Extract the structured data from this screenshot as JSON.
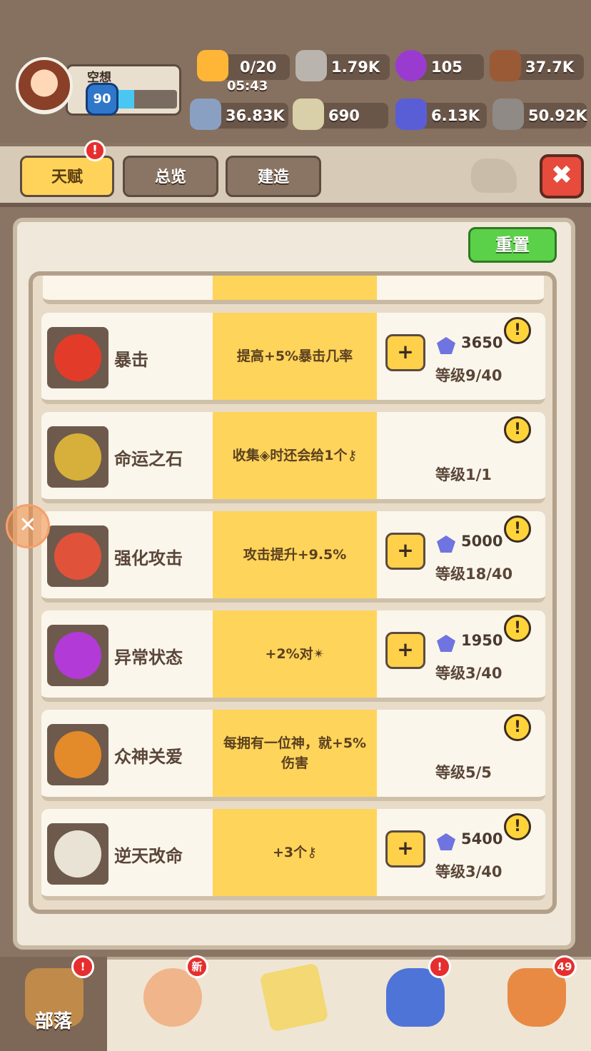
{
  "player": {
    "name": "空想",
    "level": "90",
    "xp_fraction": 0.33
  },
  "resources": {
    "energy": {
      "value": "0/20",
      "timer": "05:43",
      "icon": "meat-icon"
    },
    "nut": {
      "value": "1.79K",
      "icon": "hex-nut-icon"
    },
    "pearl": {
      "value": "105",
      "icon": "purple-pearl-icon"
    },
    "wood": {
      "value": "37.7K",
      "icon": "wood-logs-icon"
    },
    "bone": {
      "value": "36.83K",
      "icon": "bone-icon"
    },
    "fate_stone": {
      "value": "690",
      "icon": "fate-stone-icon"
    },
    "gem": {
      "value": "6.13K",
      "icon": "blue-gem-icon"
    },
    "stone": {
      "value": "50.92K",
      "icon": "rock-icon"
    }
  },
  "tabs": {
    "talent": "天赋",
    "overview": "总览",
    "build": "建造",
    "talent_alert": "!"
  },
  "reset_label": "重置",
  "talents": [
    {
      "title": "暴击",
      "desc": "提高+5%暴击几率",
      "plus": "+",
      "cost": "3650",
      "level": "等级9/40",
      "info": "!",
      "icon": "fist-icon",
      "color": "#e33b2a"
    },
    {
      "title": "命运之石",
      "desc": "收集◈时还会给1个⚷",
      "plus": "",
      "cost": "",
      "level": "等级1/1",
      "info": "!",
      "icon": "golden-key-icon",
      "color": "#d6b03a"
    },
    {
      "title": "强化攻击",
      "desc": "攻击提升+9.5%",
      "plus": "+",
      "cost": "5000",
      "level": "等级18/40",
      "info": "!",
      "icon": "sword-icon",
      "color": "#e0523a"
    },
    {
      "title": "异常状态",
      "desc": "+2%对✴",
      "plus": "+",
      "cost": "1950",
      "level": "等级3/40",
      "info": "!",
      "icon": "status-burst-icon",
      "color": "#b23ad6"
    },
    {
      "title": "众神关爱",
      "desc": "每拥有一位神，就+5%伤害",
      "plus": "",
      "cost": "",
      "level": "等级5/5",
      "info": "!",
      "icon": "god-ring-icon",
      "color": "#e38a2a"
    },
    {
      "title": "逆天改命",
      "desc": "+3个⚷",
      "plus": "+",
      "cost": "5400",
      "level": "等级3/40",
      "info": "!",
      "icon": "key-arrow-lv-icon",
      "color": "#e9e3d6"
    }
  ],
  "bottom_nav": [
    {
      "label": "部落",
      "badge": "!",
      "icon": "tribe-totem-icon"
    },
    {
      "label": "",
      "badge": "新",
      "icon": "hero-face-icon"
    },
    {
      "label": "",
      "badge": "",
      "icon": "treasure-map-icon"
    },
    {
      "label": "",
      "badge": "!",
      "icon": "wolf-pet-icon"
    },
    {
      "label": "",
      "badge": "49",
      "icon": "loot-bag-icon"
    }
  ]
}
